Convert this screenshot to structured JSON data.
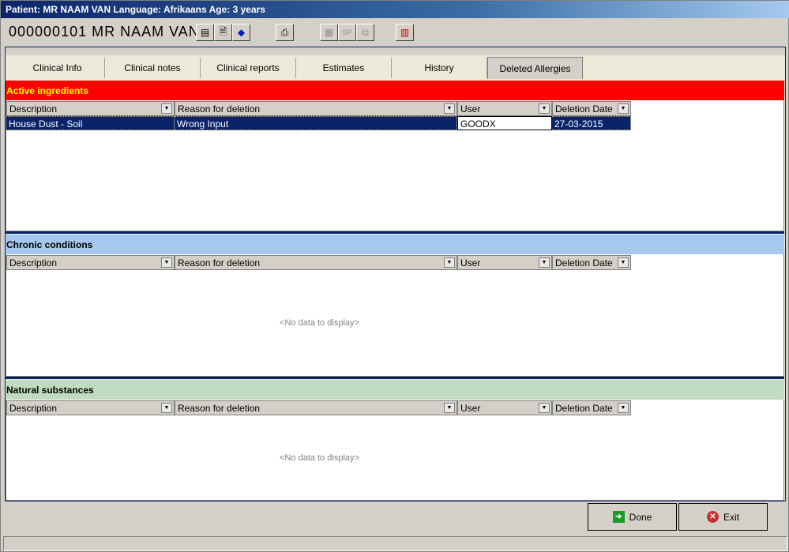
{
  "title": "Patient: MR NAAM VAN  Language: Afrikaans Age: 3 years",
  "patient_id": "000000101  MR NAAM VAN",
  "toolbar": [
    "copy-pages-icon",
    "document-icon",
    "book-icon",
    "printer-icon",
    "grid-doc-icon",
    "sp-icon",
    "export-icon",
    "chart-icon"
  ],
  "tabs": [
    "Clinical Info",
    "Clinical notes",
    "Clinical reports",
    "Estimates",
    "History",
    "Deleted Allergies"
  ],
  "columns": [
    "Description",
    "Reason for deletion",
    "User",
    "Deletion Date"
  ],
  "sections": [
    {
      "title": "Active ingredients",
      "color": "#ff0000",
      "rows": [
        {
          "description": "House Dust - Soil",
          "reason": "Wrong Input",
          "user": "GOODX",
          "date": "27-03-2015"
        }
      ]
    },
    {
      "title": "Chronic conditions",
      "color": "#a6c8ee",
      "empty": "<No data to display>"
    },
    {
      "title": "Natural substances",
      "color": "#c0dcc0",
      "empty": "<No data to display>"
    }
  ],
  "buttons": {
    "done": "Done",
    "exit": "Exit"
  }
}
